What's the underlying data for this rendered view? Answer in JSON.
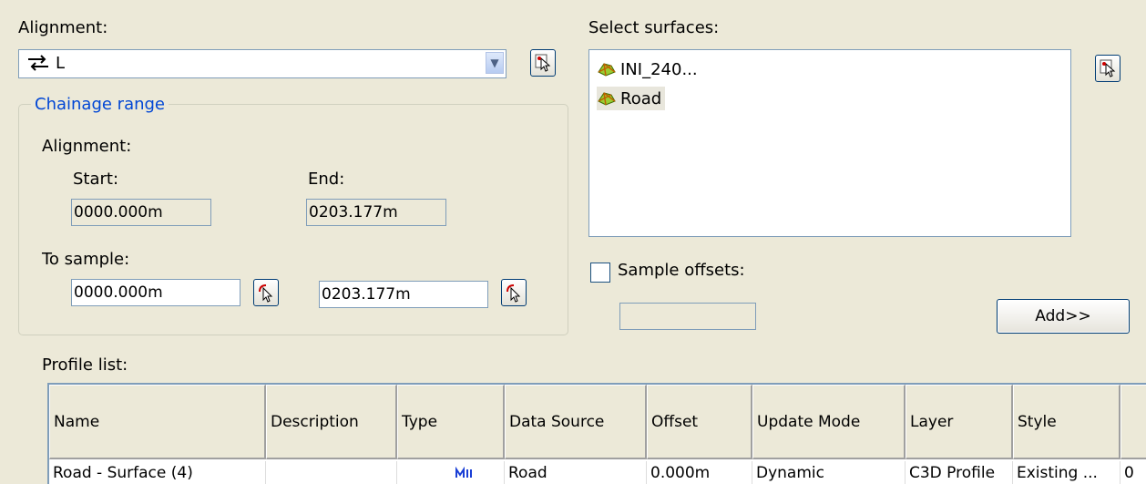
{
  "alignment": {
    "label": "Alignment:",
    "selected": "L",
    "icon": "alignment-arrows-icon"
  },
  "chainage": {
    "group_title": "Chainage range",
    "alignment_label": "Alignment:",
    "start_label": "Start:",
    "start_value": "0000.000m",
    "end_label": "End:",
    "end_value": "0203.177m",
    "sample_label": "To sample:",
    "sample_start": "0000.000m",
    "sample_end": "0203.177m"
  },
  "surfaces": {
    "label": "Select surfaces:",
    "items": [
      {
        "name": "INI_240...",
        "icon": "surface-icon"
      },
      {
        "name": "Road",
        "icon": "surface-icon",
        "selected": true
      }
    ]
  },
  "sample_offsets": {
    "label": "Sample offsets:",
    "checked": false,
    "value": ""
  },
  "add_button": "Add>>",
  "profile_list": {
    "label": "Profile list:",
    "columns": [
      "Name",
      "Description",
      "Type",
      "Data Source",
      "Offset",
      "Update Mode",
      "Layer",
      "Style"
    ],
    "rows": [
      {
        "name": "Road - Surface (4)",
        "description": "",
        "type_icon": "profile-type-icon",
        "data_source": "Road",
        "offset": "0.000m",
        "update_mode": "Dynamic",
        "layer": "C3D Profile",
        "style": "Existing ...",
        "extra": "0"
      }
    ]
  }
}
